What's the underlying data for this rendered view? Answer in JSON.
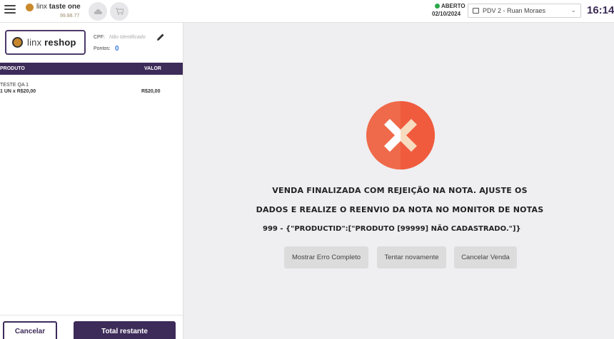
{
  "header": {
    "menu_icon": "hamburger-icon",
    "brand_name_prefix": "linx",
    "brand_name_bold": "taste one",
    "brand_code": "99.88.77",
    "circle_icons": [
      "cloud-icon",
      "cart-icon"
    ],
    "status_label": "ABERTO",
    "status_color": "#2aa84a",
    "status_date": "02/10/2024",
    "pdv_label": "PDV 2 - Ruan Moraes",
    "clock": "16:14"
  },
  "customer": {
    "logo_text_light": "linx",
    "logo_text_bold": "reshop",
    "cpf_label": "CPF:",
    "cpf_value": "Não Identificado",
    "pontos_label": "Pontos:",
    "pontos_value": "0"
  },
  "table": {
    "columns": [
      "PRODUTO",
      "VALOR"
    ],
    "items": [
      {
        "name": "TESTE QA 1",
        "qty": "1 UN x R$20,00",
        "value": "R$20,00"
      }
    ]
  },
  "footer": {
    "cancel_label": "Cancelar",
    "total_label": "Total restante"
  },
  "error": {
    "icon": "error-x-icon",
    "line1": "VENDA FINALIZADA COM REJEIÇÃO NA NOTA. AJUSTE OS",
    "line2": "DADOS E REALIZE O REENVIO DA NOTA NO MONITOR DE NOTAS",
    "line3": "999 - {\"PRODUCTID\":[\"PRODUTO [99999] NÃO CADASTRADO.\"]}",
    "buttons": {
      "show_error": "Mostrar Erro Completo",
      "retry": "Tentar novamente",
      "cancel_sale": "Cancelar Venda"
    }
  },
  "colors": {
    "primary": "#3d2b59",
    "error_red": "#ef6a4a",
    "error_light": "#f6d4b6"
  }
}
